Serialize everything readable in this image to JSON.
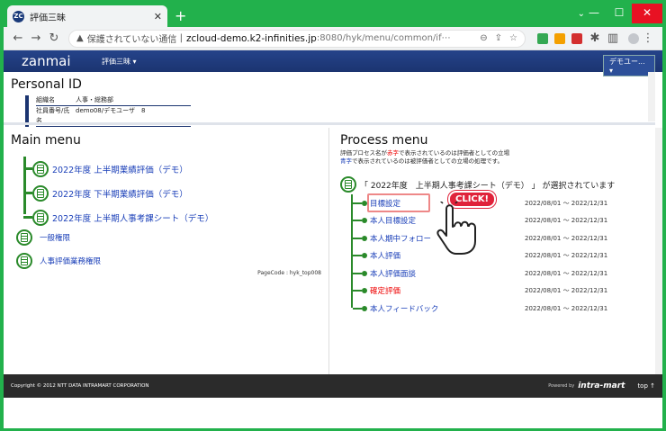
{
  "browser": {
    "tab_title": "評価三昧",
    "favicon_text": "ZC",
    "url_warning": "保護されていない通信",
    "url_host": "zcloud-demo.k2-infinities.jp",
    "url_path": ":8080/hyk/menu/common/if⋯"
  },
  "app": {
    "logo": "zanmai",
    "menu_label": "評価三昧 ▾",
    "user_button": "デモユー... ▾"
  },
  "personal": {
    "title": "Personal ID",
    "rows": [
      {
        "key": "組織名",
        "value": "人事・総務部"
      },
      {
        "key": "社員番号/氏名",
        "value": "demo08/デモユーザ　8"
      }
    ]
  },
  "main_menu": {
    "title": "Main menu",
    "items": [
      "2022年度 上半期業績評価（デモ）",
      "2022年度 下半期業績評価（デモ）",
      "2022年度 上半期人事考課シート（デモ）"
    ],
    "plain_items": [
      "一般権限",
      "人事評価業務権限"
    ],
    "page_code": "PageCode : hyk_top008"
  },
  "process_menu": {
    "title": "Process menu",
    "note1_pre": "評価プロセス名が",
    "note1_red": "赤字",
    "note1_post": "で表示されているのは評価者としての立場",
    "note2_blue": "青字",
    "note2_post": "で表示されているのは被評価者としての立場の処理です。",
    "selected_text": "「 2022年度　上半期人事考課シート（デモ） 」 が選択されています",
    "items": [
      {
        "label": "目標設定",
        "date": "2022/08/01 ～ 2022/12/31"
      },
      {
        "label": "本人目標設定",
        "date": "2022/08/01 ～ 2022/12/31"
      },
      {
        "label": "本人期中フォロー",
        "date": "2022/08/01 ～ 2022/12/31"
      },
      {
        "label": "本人評価",
        "date": "2022/08/01 ～ 2022/12/31"
      },
      {
        "label": "本人評価面談",
        "date": "2022/08/01 ～ 2022/12/31"
      },
      {
        "label": "確定評価",
        "date": "2022/08/01 ～ 2022/12/31"
      },
      {
        "label": "本人フィードバック",
        "date": "2022/08/01 ～ 2022/12/31"
      }
    ],
    "callout": "CLICK!"
  },
  "footer": {
    "copyright": "Copyright © 2012 NTT DATA INTRAMART CORPORATION",
    "powered": "Powered by",
    "brand": "intra-mart",
    "top": "top ↑"
  }
}
